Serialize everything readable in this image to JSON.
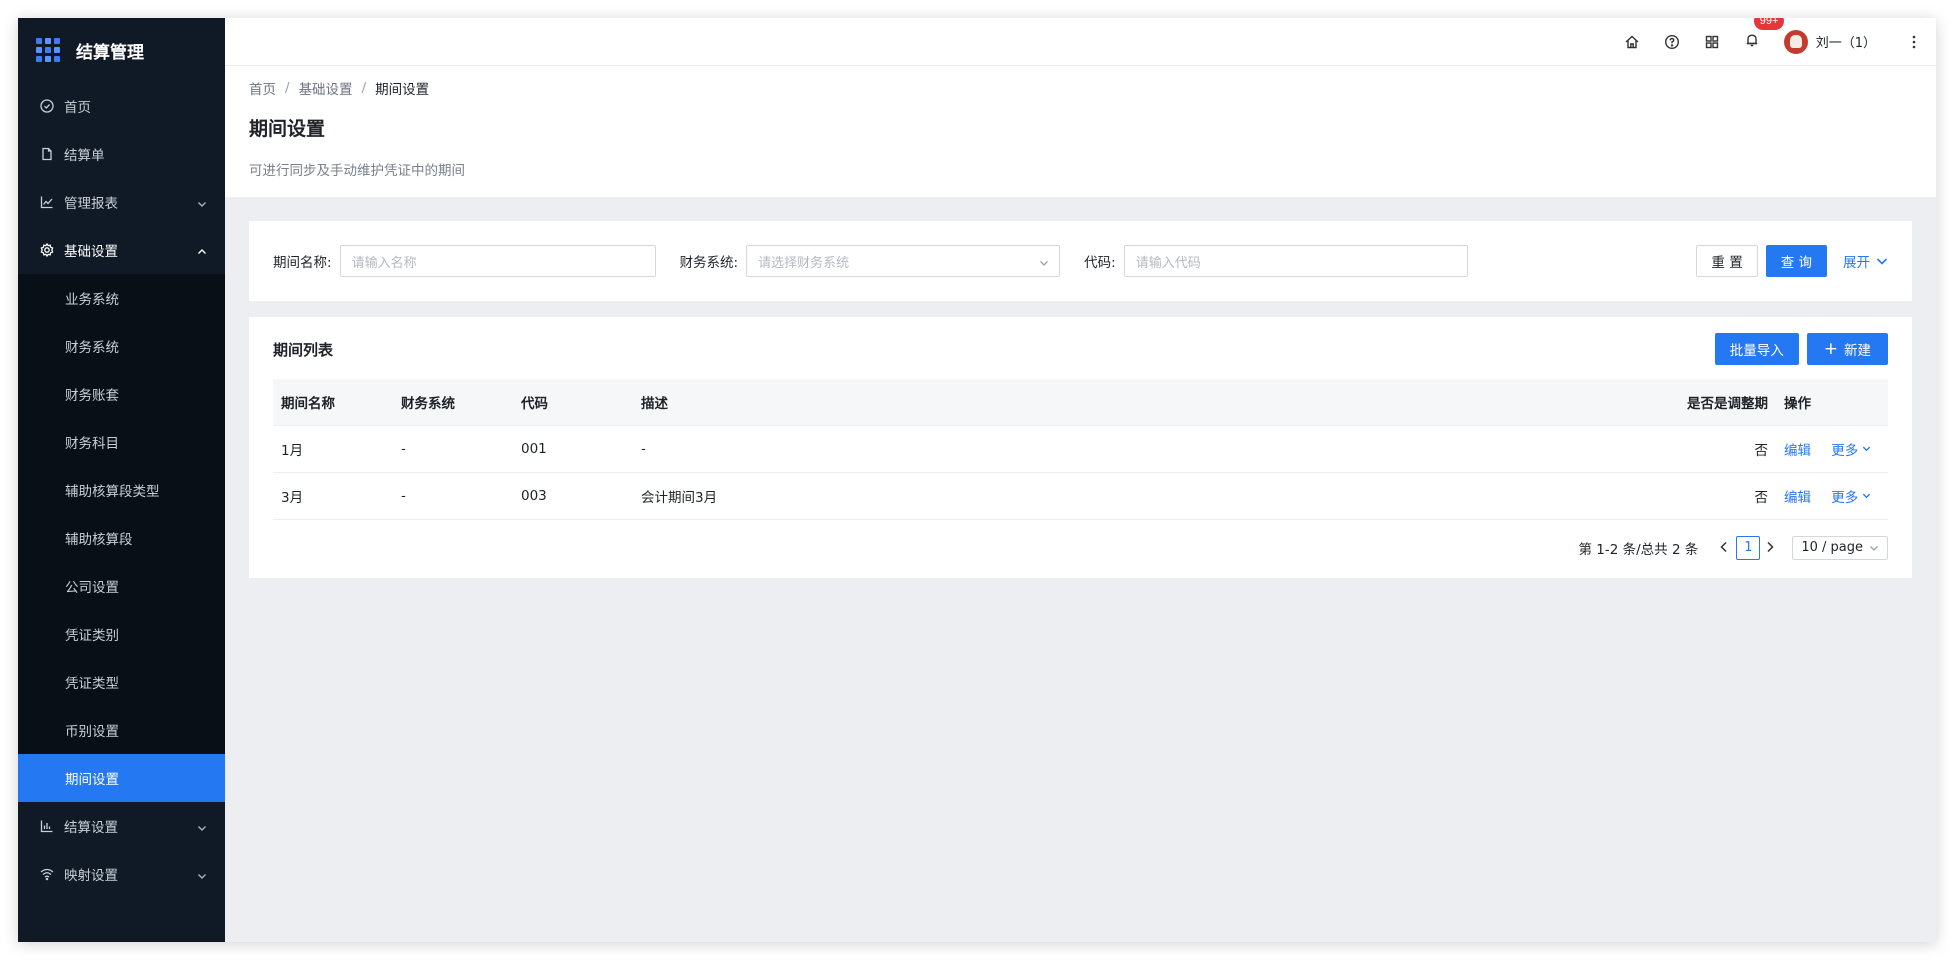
{
  "app": {
    "title": "结算管理"
  },
  "sidebar": {
    "items": [
      {
        "label": "首页",
        "icon": "dashboard-icon"
      },
      {
        "label": "结算单",
        "icon": "file-icon"
      },
      {
        "label": "管理报表",
        "icon": "line-chart-icon"
      },
      {
        "label": "基础设置",
        "icon": "gear-icon"
      }
    ],
    "submenu": [
      "业务系统",
      "财务系统",
      "财务账套",
      "财务科目",
      "辅助核算段类型",
      "辅助核算段",
      "公司设置",
      "凭证类别",
      "凭证类型",
      "币别设置",
      "期间设置"
    ],
    "bottom_items": [
      {
        "label": "结算设置",
        "icon": "bar-chart-icon"
      },
      {
        "label": "映射设置",
        "icon": "wifi-icon"
      }
    ]
  },
  "topbar": {
    "notification_badge": "99+",
    "username": "刘一（1）"
  },
  "breadcrumb": {
    "home": "首页",
    "parent": "基础设置",
    "current": "期间设置"
  },
  "page": {
    "title": "期间设置",
    "description": "可进行同步及手动维护凭证中的期间"
  },
  "filter": {
    "name_label": "期间名称:",
    "name_placeholder": "请输入名称",
    "system_label": "财务系统:",
    "system_placeholder": "请选择财务系统",
    "code_label": "代码:",
    "code_placeholder": "请输入代码",
    "reset_label": "重 置",
    "query_label": "查 询",
    "expand_label": "展开"
  },
  "list": {
    "title": "期间列表",
    "import_label": "批量导入",
    "new_label": "新建",
    "columns": [
      "期间名称",
      "财务系统",
      "代码",
      "描述",
      "是否是调整期",
      "操作"
    ],
    "rows": [
      {
        "name": "1月",
        "system": "-",
        "code": "001",
        "desc": "-",
        "adjust": "否",
        "edit": "编辑",
        "more": "更多"
      },
      {
        "name": "3月",
        "system": "-",
        "code": "003",
        "desc": "会计期间3月",
        "adjust": "否",
        "edit": "编辑",
        "more": "更多"
      }
    ]
  },
  "pagination": {
    "total_text": "第 1-2 条/总共 2 条",
    "current_page": "1",
    "page_size": "10 / page"
  },
  "colors": {
    "primary": "#2478f2",
    "sidebar_bg": "#0f1a26",
    "badge": "#e5363a"
  }
}
